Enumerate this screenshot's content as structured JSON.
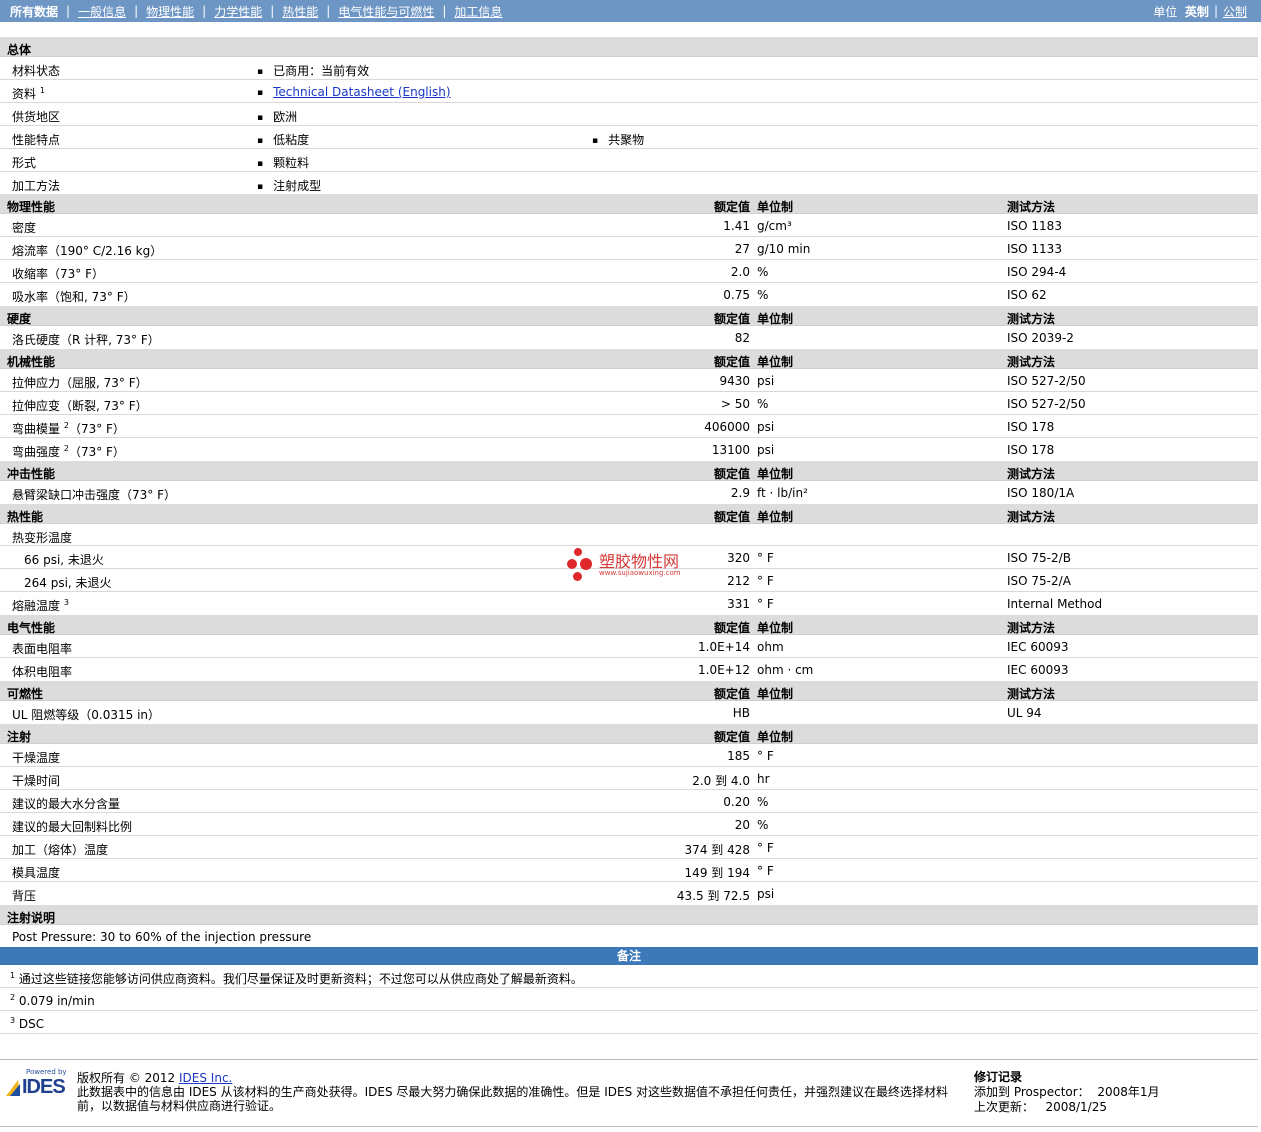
{
  "nav": {
    "tabs": [
      "所有数据",
      "一般信息",
      "物理性能",
      "力学性能",
      "热性能",
      "电气性能与可燃性",
      "加工信息"
    ],
    "units_label": "单位",
    "unit_english": "英制",
    "unit_metric": "公制"
  },
  "general": {
    "title": "总体",
    "status_label": "材料状态",
    "status_value": "已商用：当前有效",
    "doc_label": "资料",
    "doc_sup": "1",
    "doc_link": "Technical Datasheet (English)",
    "region_label": "供货地区",
    "region_value": "欧洲",
    "features_label": "性能特点",
    "feature_1": "低粘度",
    "feature_2": "共聚物",
    "form_label": "形式",
    "form_value": "颗粒料",
    "process_label": "加工方法",
    "process_value": "注射成型"
  },
  "headers": {
    "value": "额定值",
    "unit": "单位制",
    "method": "测试方法"
  },
  "physical": {
    "title": "物理性能",
    "rows": [
      {
        "label": "密度",
        "value": "1.41",
        "unit": "g/cm³",
        "method": "ISO 1183"
      },
      {
        "label": "熔流率（190° C/2.16 kg）",
        "value": "27",
        "unit": "g/10 min",
        "method": "ISO 1133"
      },
      {
        "label": "收缩率（73° F）",
        "value": "2.0",
        "unit": "%",
        "method": "ISO 294-4"
      },
      {
        "label": "吸水率（饱和, 73° F）",
        "value": "0.75",
        "unit": "%",
        "method": "ISO 62"
      }
    ]
  },
  "hardness": {
    "title": "硬度",
    "rows": [
      {
        "label": "洛氏硬度（R 计秤, 73° F）",
        "value": "82",
        "unit": "",
        "method": "ISO 2039-2"
      }
    ]
  },
  "mechanical": {
    "title": "机械性能",
    "rows": [
      {
        "label": "拉伸应力（屈服, 73° F）",
        "value": "9430",
        "unit": "psi",
        "method": "ISO 527-2/50"
      },
      {
        "label": "拉伸应变（断裂, 73° F）",
        "value": "> 50",
        "unit": "%",
        "method": "ISO 527-2/50"
      },
      {
        "label": "弯曲模量",
        "sup": "2",
        "label2": "（73° F）",
        "value": "406000",
        "unit": "psi",
        "method": "ISO 178"
      },
      {
        "label": "弯曲强度",
        "sup": "2",
        "label2": "（73° F）",
        "value": "13100",
        "unit": "psi",
        "method": "ISO 178"
      }
    ]
  },
  "impact": {
    "title": "冲击性能",
    "rows": [
      {
        "label": "悬臂梁缺口冲击强度（73° F）",
        "value": "2.9",
        "unit": "ft · lb/in²",
        "method": "ISO 180/1A"
      }
    ]
  },
  "thermal": {
    "title": "热性能",
    "hdt_label": "热变形温度",
    "rows": [
      {
        "label": "66 psi, 未退火",
        "value": "320",
        "unit": "° F",
        "method": "ISO 75-2/B"
      },
      {
        "label": "264 psi, 未退火",
        "value": "212",
        "unit": "° F",
        "method": "ISO 75-2/A"
      }
    ],
    "melt": {
      "label": "熔融温度",
      "sup": "3",
      "value": "331",
      "unit": "° F",
      "method": "Internal Method"
    }
  },
  "electrical": {
    "title": "电气性能",
    "rows": [
      {
        "label": "表面电阻率",
        "value": "1.0E+14",
        "unit": "ohm",
        "method": "IEC 60093"
      },
      {
        "label": "体积电阻率",
        "value": "1.0E+12",
        "unit": "ohm · cm",
        "method": "IEC 60093"
      }
    ]
  },
  "flammability": {
    "title": "可燃性",
    "rows": [
      {
        "label": "UL 阻燃等级（0.0315 in）",
        "value": "HB",
        "unit": "",
        "method": "UL 94"
      }
    ]
  },
  "injection": {
    "title": "注射",
    "rows": [
      {
        "label": "干燥温度",
        "value": "185",
        "unit": "° F"
      },
      {
        "label": "干燥时间",
        "value": "2.0 到  4.0",
        "unit": "hr"
      },
      {
        "label": "建议的最大水分含量",
        "value": "0.20",
        "unit": "%"
      },
      {
        "label": "建议的最大回制料比例",
        "value": "20",
        "unit": "%"
      },
      {
        "label": "加工（熔体）温度",
        "value": "374 到  428",
        "unit": "° F"
      },
      {
        "label": "模具温度",
        "value": "149 到  194",
        "unit": "° F"
      },
      {
        "label": "背压",
        "value": "43.5 到  72.5",
        "unit": "psi"
      }
    ]
  },
  "injection_notes": {
    "title": "注射说明",
    "text": "Post Pressure: 30 to 60% of the injection pressure"
  },
  "notes": {
    "title": "备注",
    "items": [
      {
        "sup": "1",
        "text": "通过这些链接您能够访问供应商资料。我们尽量保证及时更新资料；不过您可以从供应商处了解最新资料。"
      },
      {
        "sup": "2",
        "text": "0.079 in/min"
      },
      {
        "sup": "3",
        "text": "DSC"
      }
    ]
  },
  "watermark": {
    "text": "塑胶物性网",
    "url": "www.sujiaowuxing.com"
  },
  "footer": {
    "logo_powered": "Powered by",
    "logo_text": "IDES",
    "copyright_prefix": "版权所有 © 2012",
    "copyright_link": "IDES Inc.",
    "copyright_text": "此数据表中的信息由 IDES 从该材料的生产商处获得。IDES 尽最大努力确保此数据的准确性。但是 IDES 对这些数据值不承担任何责任，并强烈建议在最终选择材料前，以数据值与材料供应商进行验证。",
    "rev_title": "修订记录",
    "added_label": "添加到 Prospector：",
    "added_value": "2008年1月",
    "updated_label": "上次更新：",
    "updated_value": "2008/1/25"
  }
}
